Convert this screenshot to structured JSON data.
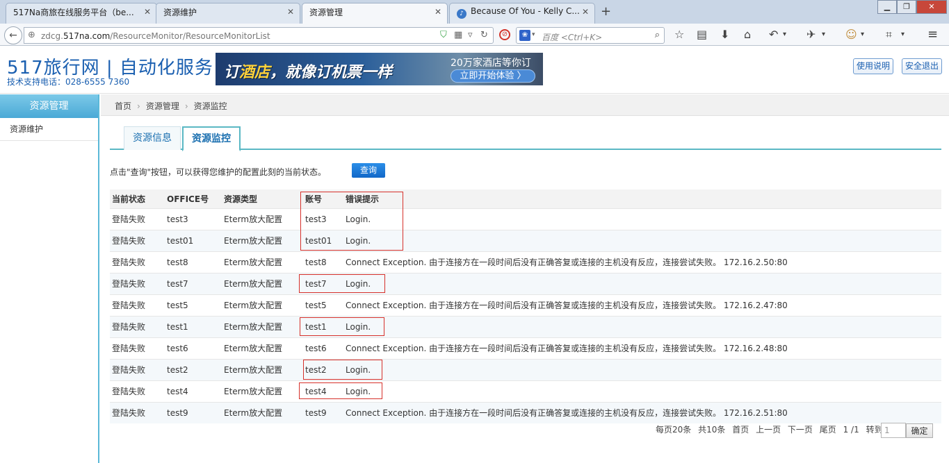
{
  "browser": {
    "tabs": [
      {
        "label": "517Na商旅在线服务平台（be...",
        "active": false
      },
      {
        "label": "资源维护",
        "active": false
      },
      {
        "label": "资源管理",
        "active": true
      },
      {
        "label": "Because Of You - Kelly C...",
        "active": false
      }
    ],
    "new_tab": "+",
    "url_prefix": "zdcg.",
    "url_domain": "517na.com",
    "url_path": "/ResourceMonitor/ResourceMonitorList",
    "search_placeholder": "百度 <Ctrl+K>",
    "window_buttons": {
      "minimize": "▁",
      "maximize": "❐",
      "close": "✕"
    }
  },
  "header": {
    "title": "517旅行网 | 自动化服务",
    "support_phone": "技术支持电话：028-6555 7360",
    "banner": {
      "main_prefix": "订",
      "main_highlight": "酒店",
      "main_suffix": "，就像订机票一样",
      "sub": "20万家酒店等你订",
      "cta": "立即开始体验 〉"
    },
    "help_button": "使用说明",
    "logout_button": "安全退出"
  },
  "sidebar": {
    "title": "资源管理",
    "items": [
      {
        "label": "资源维护"
      }
    ]
  },
  "breadcrumb": {
    "items": [
      "首页",
      "资源管理",
      "资源监控"
    ],
    "separator": "›"
  },
  "tabs": [
    {
      "label": "资源信息",
      "active": false
    },
    {
      "label": "资源监控",
      "active": true
    }
  ],
  "hint": "点击\"查询\"按钮，可以获得您维护的配置此刻的当前状态。",
  "query_button": "查询",
  "table": {
    "headers": [
      "当前状态",
      "OFFICE号",
      "资源类型",
      "账号",
      "错误提示"
    ],
    "rows": [
      [
        "登陆失败",
        "test3",
        "Eterm放大配置",
        "test3",
        "Login."
      ],
      [
        "登陆失败",
        "test01",
        "Eterm放大配置",
        "test01",
        "Login."
      ],
      [
        "登陆失败",
        "test8",
        "Eterm放大配置",
        "test8",
        "Connect Exception. 由于连接方在一段时间后没有正确答复或连接的主机没有反应，连接尝试失败。 172.16.2.50:80"
      ],
      [
        "登陆失败",
        "test7",
        "Eterm放大配置",
        "test7",
        "Login."
      ],
      [
        "登陆失败",
        "test5",
        "Eterm放大配置",
        "test5",
        "Connect Exception. 由于连接方在一段时间后没有正确答复或连接的主机没有反应，连接尝试失败。 172.16.2.47:80"
      ],
      [
        "登陆失败",
        "test1",
        "Eterm放大配置",
        "test1",
        "Login."
      ],
      [
        "登陆失败",
        "test6",
        "Eterm放大配置",
        "test6",
        "Connect Exception. 由于连接方在一段时间后没有正确答复或连接的主机没有反应，连接尝试失败。 172.16.2.48:80"
      ],
      [
        "登陆失败",
        "test2",
        "Eterm放大配置",
        "test2",
        "Login."
      ],
      [
        "登陆失败",
        "test4",
        "Eterm放大配置",
        "test4",
        "Login."
      ],
      [
        "登陆失败",
        "test9",
        "Eterm放大配置",
        "test9",
        "Connect Exception. 由于连接方在一段时间后没有正确答复或连接的主机没有反应，连接尝试失败。 172.16.2.51:80"
      ]
    ]
  },
  "pager": {
    "per_page": "每页20条",
    "total": "共10条",
    "first": "首页",
    "prev": "上一页",
    "next": "下一页",
    "last": "尾页",
    "page_info": "1 /1",
    "goto": "转到:",
    "input_placeholder": "1",
    "confirm": "确定"
  },
  "colors": {
    "brand": "#1a5fb0",
    "accent": "#5ab8c4",
    "highlight_box": "#d6302a"
  }
}
